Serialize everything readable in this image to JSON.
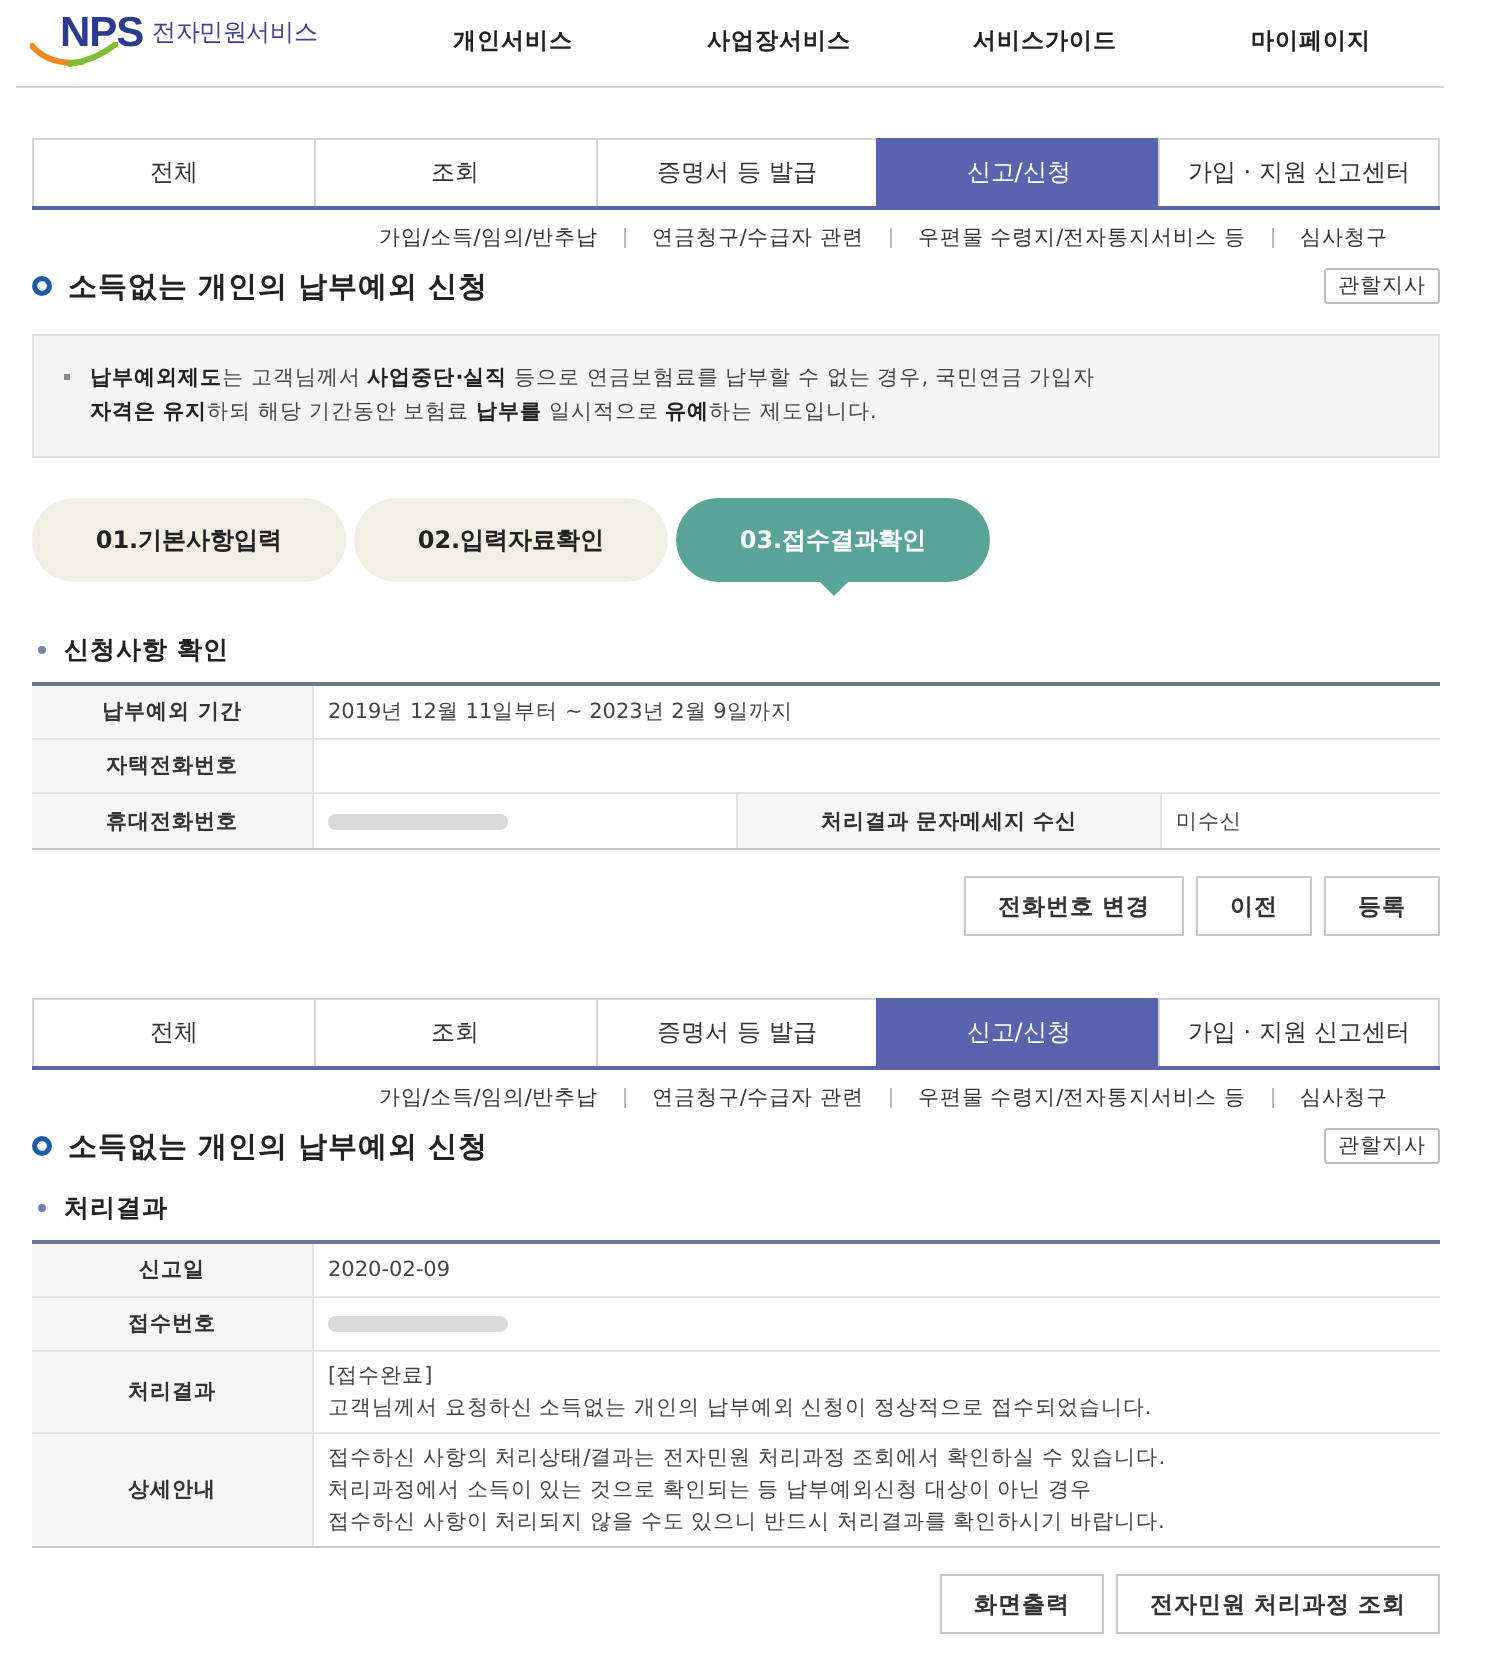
{
  "header": {
    "logo": {
      "mark": "NPS",
      "name": "전자민원서비스"
    },
    "nav": [
      "개인서비스",
      "사업장서비스",
      "서비스가이드",
      "마이페이지"
    ]
  },
  "sections": [
    {
      "tabs": [
        {
          "label": "전체",
          "selected": false
        },
        {
          "label": "조회",
          "selected": false
        },
        {
          "label": "증명서 등 발급",
          "selected": false
        },
        {
          "label": "신고/신청",
          "selected": true
        },
        {
          "label": "가입 · 지원 신고센터",
          "selected": false
        }
      ],
      "sublinks": [
        "가입/소득/임의/반추납",
        "연금청구/수급자 관련",
        "우편물 수령지/전자통지서비스 등",
        "심사청구"
      ],
      "title": "소득없는 개인의 납부예외 신청",
      "title_button": "관할지사",
      "info": [
        "**납부예외제도**는 고객님께서 **사업중단·실직** 등으로 연금보험료를 납부할 수 없는 경우, 국민연금 가입자",
        "**자격은 유지**하되 해당 기간동안 보험료 **납부를** 일시적으로 **유예**하는 제도입니다."
      ],
      "steps": [
        {
          "label": "01.기본사항입력",
          "selected": false
        },
        {
          "label": "02.입력자료확인",
          "selected": false
        },
        {
          "label": "03.접수결과확인",
          "selected": true
        }
      ],
      "subtitle": "신청사항 확인",
      "table": [
        {
          "cells": [
            {
              "kind": "label",
              "text": "납부예외 기간"
            },
            {
              "kind": "value",
              "lines": [
                "2019년 12월 11일부터 ~ 2023년 2월 9일까지"
              ]
            }
          ]
        },
        {
          "cells": [
            {
              "kind": "label",
              "text": "자택전화번호"
            }
          ]
        },
        {
          "cells": [
            {
              "kind": "label",
              "text": "휴대전화번호"
            },
            {
              "kind": "redacted"
            },
            {
              "kind": "label",
              "text": "처리결과 문자메세지 수신"
            },
            {
              "kind": "value",
              "lines": [
                "미수신"
              ]
            }
          ]
        }
      ],
      "buttons": [
        "전화번호 변경",
        "이전",
        "등록"
      ]
    },
    {
      "tabs": [
        {
          "label": "전체",
          "selected": false
        },
        {
          "label": "조회",
          "selected": false
        },
        {
          "label": "증명서 등 발급",
          "selected": false
        },
        {
          "label": "신고/신청",
          "selected": true
        },
        {
          "label": "가입 · 지원 신고센터",
          "selected": false
        }
      ],
      "sublinks": [
        "가입/소득/임의/반추납",
        "연금청구/수급자 관련",
        "우편물 수령지/전자통지서비스 등",
        "심사청구"
      ],
      "title": "소득없는 개인의 납부예외 신청",
      "title_button": "관할지사",
      "subtitle": "처리결과",
      "table": [
        {
          "cells": [
            {
              "kind": "label",
              "text": "신고일"
            },
            {
              "kind": "value",
              "lines": [
                "2020-02-09"
              ]
            }
          ]
        },
        {
          "cells": [
            {
              "kind": "label",
              "text": "접수번호"
            },
            {
              "kind": "redacted"
            }
          ]
        },
        {
          "cells": [
            {
              "kind": "label",
              "text": "처리결과"
            },
            {
              "kind": "value",
              "lines": [
                "[접수완료]",
                "고객님께서 요청하신 소득없는 개인의 납부예외 신청이 정상적으로 접수되었습니다."
              ]
            }
          ]
        },
        {
          "cells": [
            {
              "kind": "label",
              "text": "상세안내"
            },
            {
              "kind": "value",
              "lines": [
                "접수하신 사항의 처리상태/결과는 전자민원 처리과정 조회에서 확인하실 수 있습니다.",
                "처리과정에서 소득이 있는 것으로 확인되는 등 납부예외신청 대상이 아닌 경우",
                "접수하신 사항이 처리되지 않을 수도 있으니 반드시 처리결과를 확인하시기 바랍니다."
              ]
            }
          ]
        }
      ],
      "buttons": [
        "화면출력",
        "전자민원 처리과정 조회"
      ]
    }
  ]
}
